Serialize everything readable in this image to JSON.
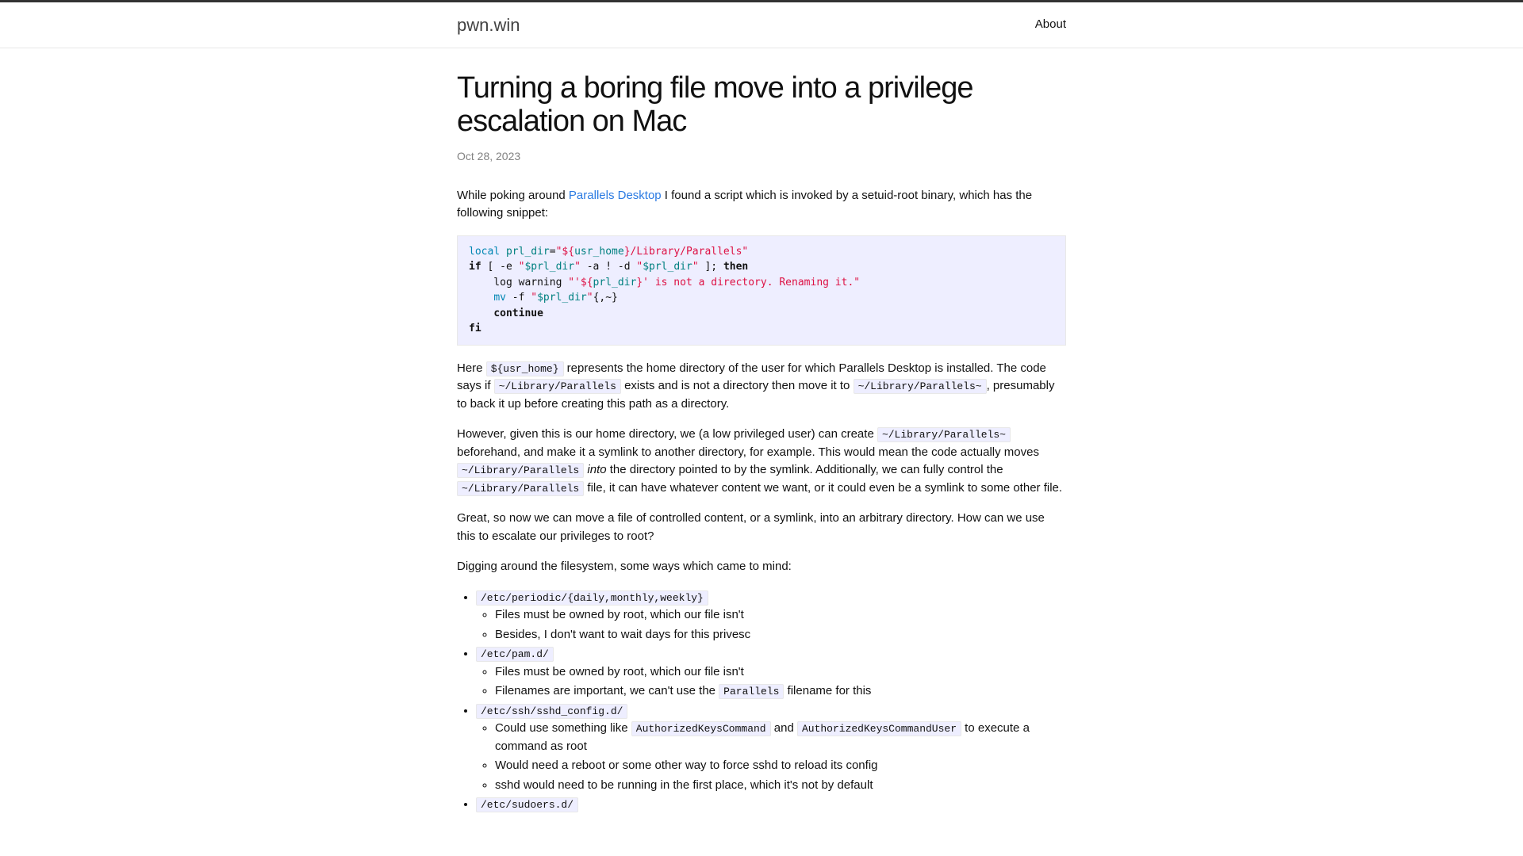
{
  "header": {
    "site_title": "pwn.win",
    "nav_about": "About"
  },
  "post": {
    "title": "Turning a boring file move into a privilege escalation on Mac",
    "date": "Oct 28, 2023",
    "p1_a": "While poking around ",
    "p1_link": "Parallels Desktop",
    "p1_b": " I found a script which is invoked by a setuid-root binary, which has the following snippet:",
    "code1": {
      "l1_local": "local",
      "l1_var": " prl_dir",
      "l1_eq": "=",
      "l1_s1": "\"",
      "l1_s2": "${",
      "l1_v": "usr_home",
      "l1_s3": "}",
      "l1_s4": "/Library/Parallels\"",
      "l2_if": "if ",
      "l2_a": "[ ",
      "l2_b": "-e ",
      "l2_s1": "\"",
      "l2_v1": "$prl_dir",
      "l2_s2": "\"",
      "l2_c": " -a ",
      "l2_d": "!",
      "l2_e": " -d ",
      "l2_s3": "\"",
      "l2_v2": "$prl_dir",
      "l2_s4": "\"",
      "l2_f": " ]",
      "l2_g": "; ",
      "l2_then": "then",
      "l3_a": "    log warning ",
      "l3_s1": "\"'",
      "l3_s2": "${",
      "l3_v": "prl_dir",
      "l3_s3": "}",
      "l3_s4": "' is not a directory. Renaming it.\"",
      "l4_pad": "    ",
      "l4_mv": "mv",
      "l4_a": " -f ",
      "l4_s1": "\"",
      "l4_v": "$prl_dir",
      "l4_s2": "\"",
      "l4_b": "{,~}",
      "l5_pad": "    ",
      "l5_cont": "continue",
      "l6_fi": "fi"
    },
    "p2_a": "Here ",
    "p2_c1": "${usr_home}",
    "p2_b": " represents the home directory of the user for which Parallels Desktop is installed. The code says if ",
    "p2_c2": "~/Library/Parallels",
    "p2_c": " exists and is not a directory then move it to ",
    "p2_c3": "~/Library/Parallels~",
    "p2_d": ", presumably to back it up before creating this path as a directory.",
    "p3_a": "However, given this is our home directory, we (a low privileged user) can create ",
    "p3_c1": "~/Library/Parallels~",
    "p3_b": " beforehand, and make it a symlink to another directory, for example. This would mean the code actually moves ",
    "p3_c2": "~/Library/Parallels",
    "p3_c": " ",
    "p3_i": "into",
    "p3_d": " the directory pointed to by the symlink. Additionally, we can fully control the ",
    "p3_c3": "~/Library/Parallels",
    "p3_e": " file, it can have whatever content we want, or it could even be a symlink to some other file.",
    "p4": "Great, so now we can move a file of controlled content, or a symlink, into an arbitrary directory. How can we use this to escalate our privileges to root?",
    "p5": "Digging around the filesystem, some ways which came to mind:",
    "list": {
      "i1_code": "/etc/periodic/{daily,monthly,weekly}",
      "i1_s1": "Files must be owned by root, which our file isn't",
      "i1_s2": "Besides, I don't want to wait days for this privesc",
      "i2_code": "/etc/pam.d/",
      "i2_s1": "Files must be owned by root, which our file isn't",
      "i2_s2a": "Filenames are important, we can't use the ",
      "i2_s2code": "Parallels",
      "i2_s2b": " filename for this",
      "i3_code": "/etc/ssh/sshd_config.d/",
      "i3_s1a": "Could use something like ",
      "i3_s1c1": "AuthorizedKeysCommand",
      "i3_s1b": " and ",
      "i3_s1c2": "AuthorizedKeysCommandUser",
      "i3_s1c": " to execute a command as root",
      "i3_s2": "Would need a reboot or some other way to force sshd to reload its config",
      "i3_s3": "sshd would need to be running in the first place, which it's not by default",
      "i4_code": "/etc/sudoers.d/"
    }
  }
}
